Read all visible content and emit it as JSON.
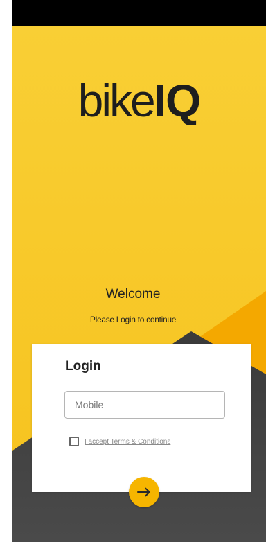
{
  "colors": {
    "brand_yellow": "#f8c92a",
    "button_orange": "#f6b500",
    "dark_band": "#3d3d3d",
    "status_bar": "#000000"
  },
  "brand": {
    "logo_light": "bike",
    "logo_bold": "IQ"
  },
  "welcome": {
    "title": "Welcome",
    "subtitle": "Please Login to continue"
  },
  "login": {
    "title": "Login",
    "mobile_placeholder": "Mobile",
    "mobile_value": "",
    "terms_label": "I accept Terms & Conditions",
    "terms_checked": false,
    "submit_icon": "arrow-right-icon"
  }
}
